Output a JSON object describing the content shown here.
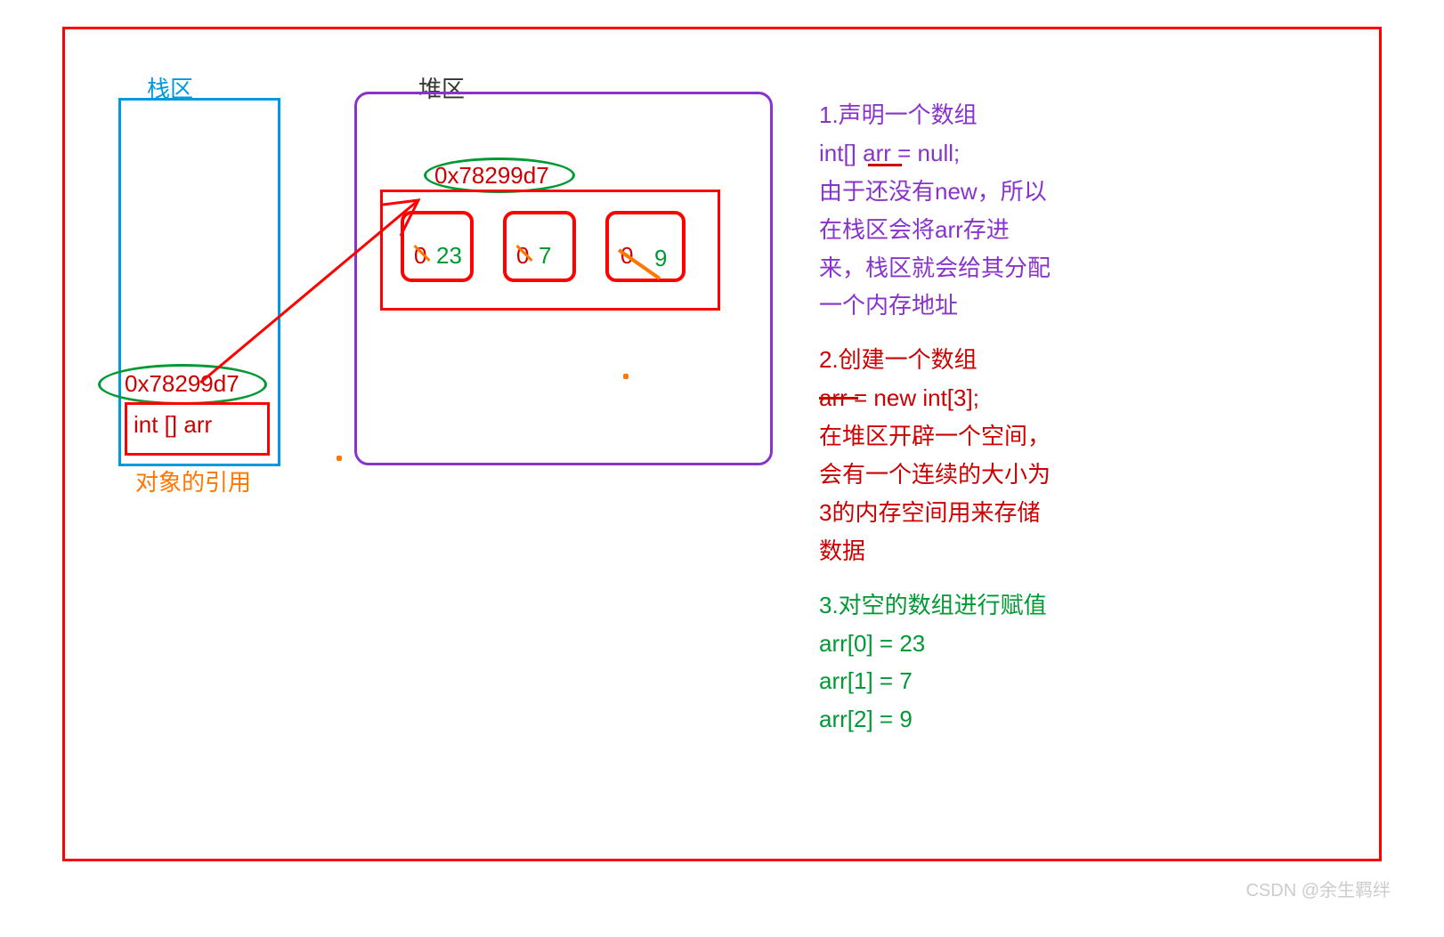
{
  "labels": {
    "stack": "栈区",
    "heap": "堆区",
    "ref": "对象的引用"
  },
  "stack": {
    "address": "0x78299d7",
    "var_decl": "int [] arr"
  },
  "heap": {
    "address": "0x78299d7",
    "cells": [
      {
        "initial": "0",
        "value": "23"
      },
      {
        "initial": "0",
        "value": "7"
      },
      {
        "initial": "0",
        "value": "9"
      }
    ]
  },
  "explain": {
    "s1_title": "1.声明一个数组",
    "s1_code": "int[] arr = null;",
    "s1_body": "由于还没有new，所以在栈区会将arr存进来，栈区就会给其分配一个内存地址",
    "s2_title": "2.创建一个数组",
    "s2_code": "arr  = new int[3];",
    "s2_body": "在堆区开辟一个空间，会有一个连续的大小为3的内存空间用来存储数据",
    "s3_title": "3.对空的数组进行赋值",
    "s3_l1": "arr[0] = 23",
    "s3_l2": "arr[1] = 7",
    "s3_l3": "arr[2] = 9"
  },
  "watermark": "CSDN @余生羁绊"
}
